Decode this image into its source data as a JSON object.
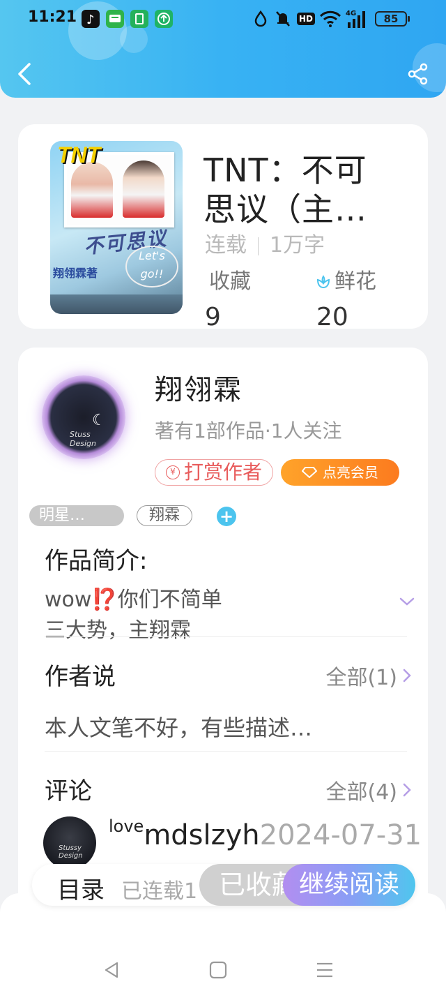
{
  "status_bar": {
    "time": "11:21",
    "network_badge": "HD",
    "signal_label": "4G",
    "battery": "85"
  },
  "header": {
    "back_icon": "back-chevron-icon",
    "share_icon": "share-icon"
  },
  "book": {
    "title_line1": "TNT：不可",
    "title_line2": "思议（主…",
    "status": "连载",
    "word_count": "1万字",
    "favorites_label": "收藏",
    "favorites_count": "9",
    "flowers_label": "鲜花",
    "flowers_count": "20",
    "cover": {
      "logo_text": "TNT",
      "calligraphy": "不可思议",
      "author_tag": "翔翎霖著",
      "letgo": "Let's go!!"
    }
  },
  "author": {
    "name": "翔翎霖",
    "meta": "著有1部作品·1人关注",
    "reward_label": "打赏作者",
    "vip_label": "点亮会员"
  },
  "tags": {
    "tag1": "明星…",
    "tag2": "翔霖",
    "add": "+"
  },
  "intro": {
    "title": "作品简介:",
    "line1": "wow⁉️你们不简单",
    "line2": "三大势，主翔霖"
  },
  "author_says": {
    "title": "作者说",
    "all_label": "全部(1)",
    "text": "本人文笔不好，有些描述…"
  },
  "comments": {
    "title": "评论",
    "all_label": "全部(4)",
    "first_user_prefix": "love",
    "first_user": "mdslzyh",
    "first_date": "2024-07-31"
  },
  "bottom_bar": {
    "directory": "目录",
    "serial": "已连载1",
    "collected": "已收藏",
    "continue": "继续阅读"
  },
  "colors": {
    "header_gradient_start": "#55c6f0",
    "header_gradient_end": "#2fa6f2",
    "reward_red": "#e85b5b",
    "vip_orange": "#fc7b1f",
    "read_gradient_start": "#b28ef0",
    "read_gradient_end": "#4fc6ee"
  }
}
